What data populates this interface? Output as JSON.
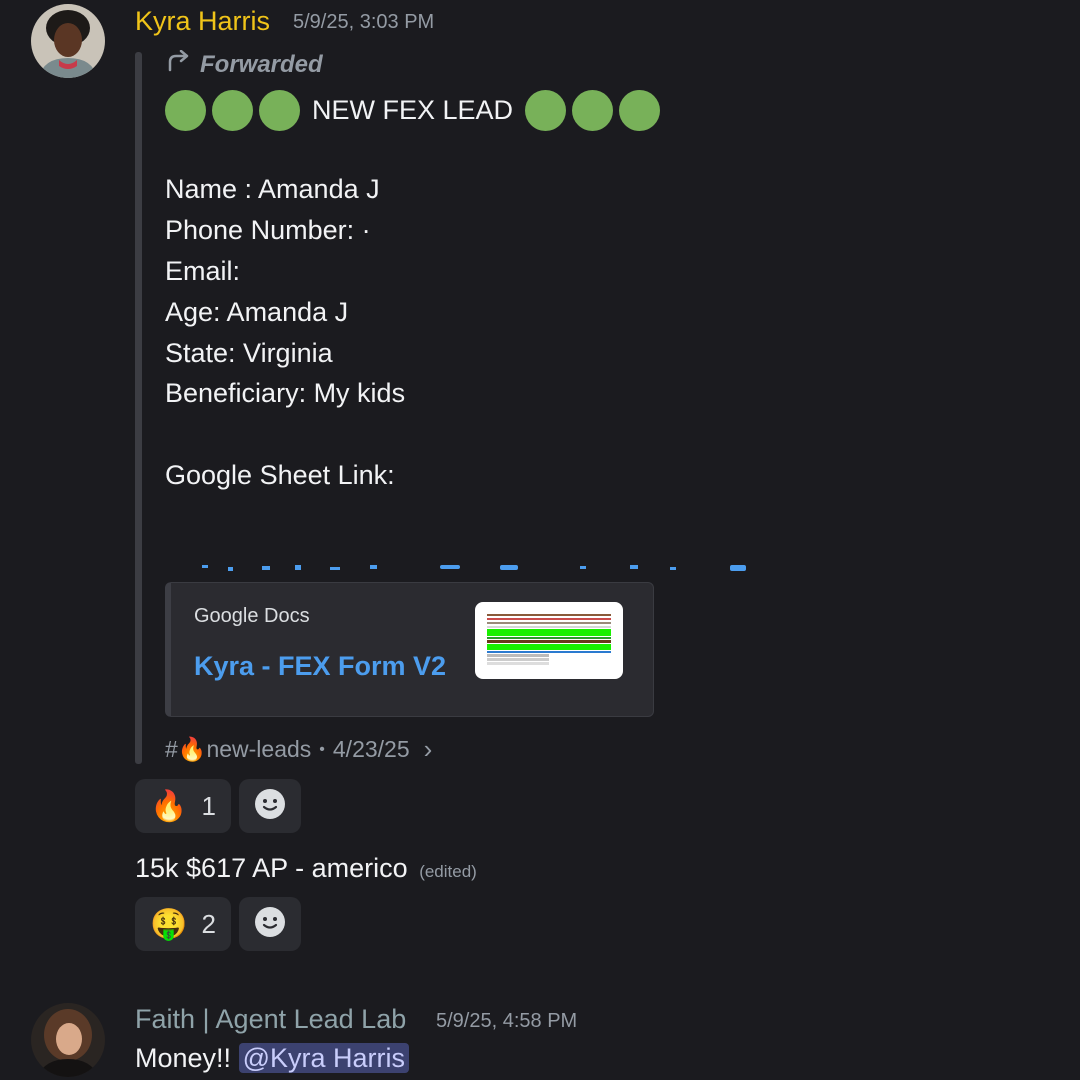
{
  "messages": [
    {
      "author": "Kyra Harris",
      "author_color": "#f0c419",
      "timestamp": "5/9/25, 3:03 PM",
      "forwarded_label": "Forwarded",
      "lead_title": "NEW FEX LEAD",
      "lead_emoji": "green-circle-icon",
      "fields": [
        "Name : Amanda J",
        "Phone Number: ·",
        "Email:",
        "Age: Amanda J",
        "State: Virginia",
        "Beneficiary: My kids",
        "Google Sheet Link:"
      ],
      "embed": {
        "provider": "Google Docs",
        "title": "Kyra - FEX Form V2",
        "thumbnail": "spreadsheet-preview"
      },
      "source": {
        "prefix": "#",
        "emoji": "🔥",
        "channel": "new-leads",
        "separator": "•",
        "date": "4/23/25",
        "chevron": "›"
      },
      "reactions": [
        {
          "emoji": "🔥",
          "count": "1"
        }
      ]
    },
    {
      "text": "15k $617 AP - americo",
      "edited_label": "(edited)",
      "reactions": [
        {
          "emoji": "🤑",
          "count": "2"
        }
      ]
    },
    {
      "author": "Faith | Agent Lead Lab",
      "author_color": "#8fa3a9",
      "timestamp": "5/9/25, 4:58 PM",
      "text": "Money!!",
      "mention": "@Kyra Harris"
    }
  ]
}
